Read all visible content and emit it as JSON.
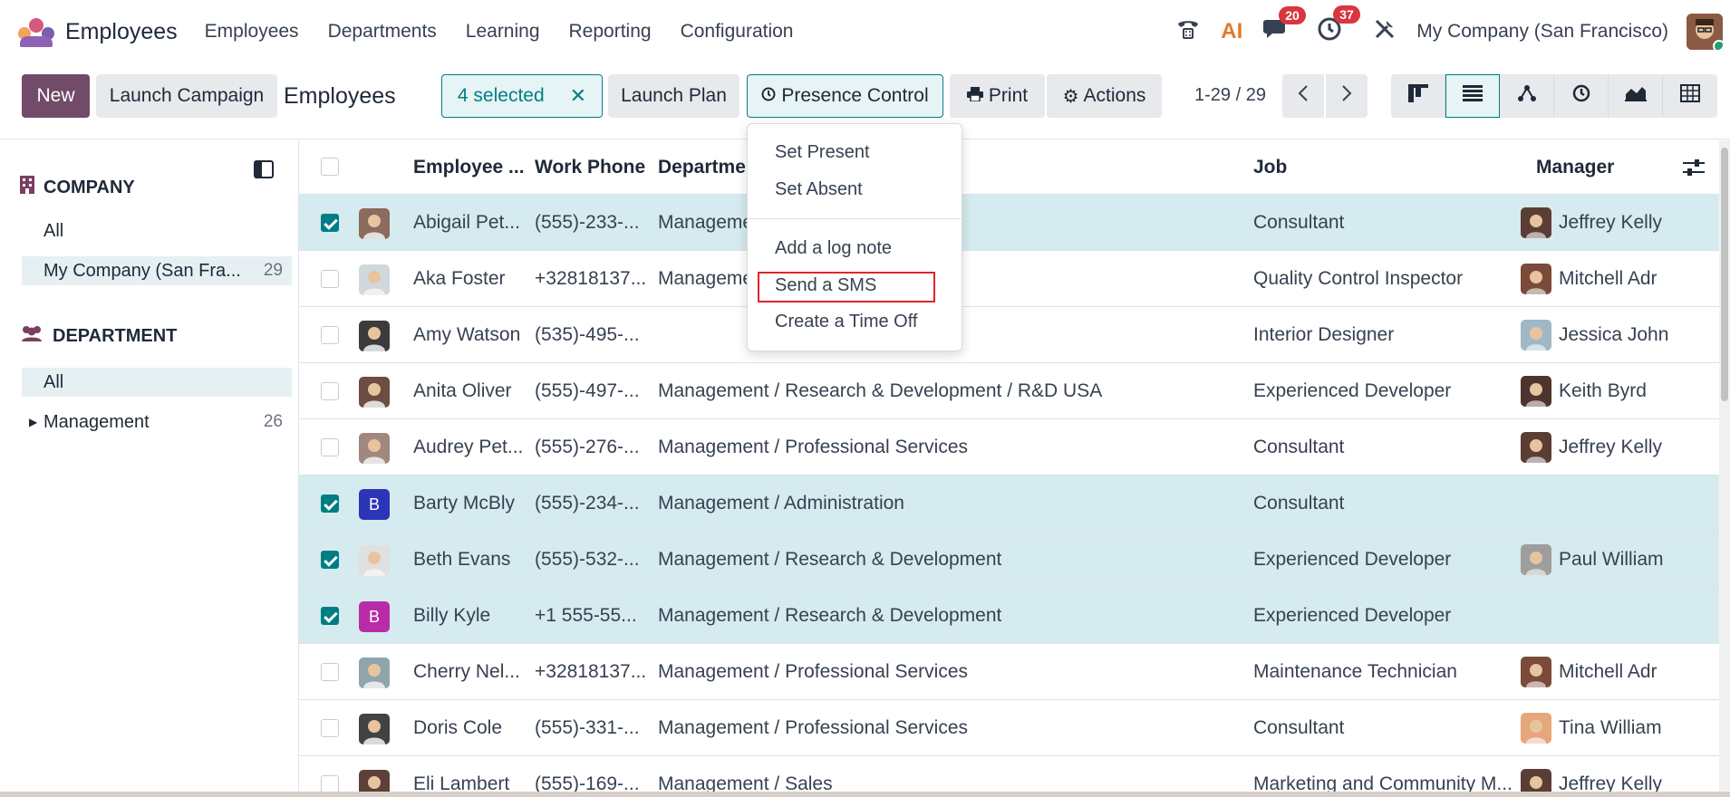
{
  "app": {
    "title": "Employees",
    "menu": [
      "Employees",
      "Departments",
      "Learning",
      "Reporting",
      "Configuration"
    ],
    "ai_label": "AI",
    "messages_count": "20",
    "activities_count": "37",
    "company": "My Company (San Francisco)"
  },
  "control": {
    "new_label": "New",
    "launch_campaign_label": "Launch Campaign",
    "breadcrumb": "Employees",
    "selected_label": "4 selected",
    "launch_plan_label": "Launch Plan",
    "presence_control_label": "Presence Control",
    "print_label": "Print",
    "actions_label": "Actions",
    "pager": "1-29 / 29"
  },
  "dropdown": {
    "items": [
      "Set Present",
      "Set Absent",
      "Add a log note",
      "Send a SMS",
      "Create a Time Off"
    ]
  },
  "sidebar": {
    "company_heading": "COMPANY",
    "company_items": [
      {
        "label": "All",
        "count": ""
      },
      {
        "label": "My Company (San Fra...",
        "count": "29"
      }
    ],
    "department_heading": "DEPARTMENT",
    "department_items": [
      {
        "label": "All",
        "count": ""
      },
      {
        "label": "Management",
        "count": "26"
      }
    ]
  },
  "table": {
    "headers": {
      "name": "Employee ...",
      "phone": "Work Phone",
      "department": "Departmen",
      "job": "Job",
      "manager": "Manager"
    },
    "rows": [
      {
        "selected": true,
        "avatar": "photo",
        "avatar_color": "#8b6b5c",
        "name": "Abigail Pet...",
        "phone": "(555)-233-...",
        "department": "Manageme",
        "job": "Consultant",
        "manager": "Jeffrey Kelly",
        "manager_color": "#5a3e36"
      },
      {
        "selected": false,
        "avatar": "photo",
        "avatar_color": "#cfd8dc",
        "name": "Aka Foster",
        "phone": "+32818137...",
        "department": "Manageme",
        "job": "Quality Control Inspector",
        "manager": "Mitchell Adr",
        "manager_color": "#7a4a3a"
      },
      {
        "selected": false,
        "avatar": "photo",
        "avatar_color": "#3b3b3b",
        "name": "Amy Watson",
        "phone": "(535)-495-...",
        "department": "",
        "job": "Interior Designer",
        "manager": "Jessica John",
        "manager_color": "#9fb8c4"
      },
      {
        "selected": false,
        "avatar": "photo",
        "avatar_color": "#6d4c41",
        "name": "Anita Oliver",
        "phone": "(555)-497-...",
        "department": "Management / Research & Development / R&D USA",
        "job": "Experienced Developer",
        "manager": "Keith Byrd",
        "manager_color": "#4e342e"
      },
      {
        "selected": false,
        "avatar": "photo",
        "avatar_color": "#a1887f",
        "name": "Audrey Pet...",
        "phone": "(555)-276-...",
        "department": "Management / Professional Services",
        "job": "Consultant",
        "manager": "Jeffrey Kelly",
        "manager_color": "#5a3e36"
      },
      {
        "selected": true,
        "avatar": "B",
        "avatar_color": "#2c35b8",
        "name": "Barty McBly",
        "phone": "(555)-234-...",
        "department": "Management / Administration",
        "job": "Consultant",
        "manager": "",
        "manager_color": ""
      },
      {
        "selected": true,
        "avatar": "photo",
        "avatar_color": "#e0e0e0",
        "name": "Beth Evans",
        "phone": "(555)-532-...",
        "department": "Management / Research & Development",
        "job": "Experienced Developer",
        "manager": "Paul William",
        "manager_color": "#9e9e9e"
      },
      {
        "selected": true,
        "avatar": "B",
        "avatar_color": "#b82ca8",
        "name": "Billy Kyle",
        "phone": "+1 555-55...",
        "department": "Management / Research & Development",
        "job": "Experienced Developer",
        "manager": "",
        "manager_color": ""
      },
      {
        "selected": false,
        "avatar": "photo",
        "avatar_color": "#90a4ae",
        "name": "Cherry Nel...",
        "phone": "+32818137...",
        "department": "Management / Professional Services",
        "job": "Maintenance Technician",
        "manager": "Mitchell Adr",
        "manager_color": "#7a4a3a"
      },
      {
        "selected": false,
        "avatar": "photo",
        "avatar_color": "#424242",
        "name": "Doris Cole",
        "phone": "(555)-331-...",
        "department": "Management / Professional Services",
        "job": "Consultant",
        "manager": "Tina William",
        "manager_color": "#e6a77a"
      },
      {
        "selected": false,
        "avatar": "photo",
        "avatar_color": "#5d4037",
        "name": "Eli Lambert",
        "phone": "(555)-169-...",
        "department": "Management / Sales",
        "job": "Marketing and Community M...",
        "manager": "Jeffrey Kelly",
        "manager_color": "#5a3e36"
      }
    ]
  },
  "colors": {
    "brand": "#714b67",
    "accent": "#017e84",
    "selected_row": "#d5ebef",
    "badge": "#d9363e",
    "highlight": "#e0262b"
  },
  "icons": {
    "phone": "phone-icon",
    "messages": "chat-icon",
    "activities": "clock-icon",
    "debug": "tools-icon",
    "views": [
      "kanban-icon",
      "list-icon",
      "hierarchy-icon",
      "activity-icon",
      "graph-icon",
      "pivot-icon"
    ]
  }
}
